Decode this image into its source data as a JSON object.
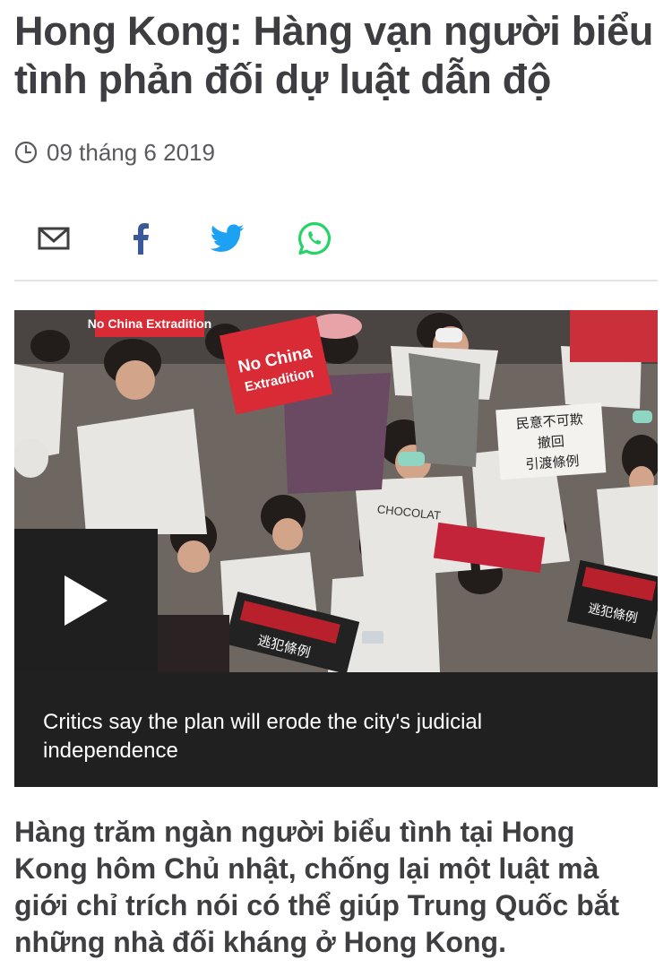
{
  "article": {
    "headline": "Hong Kong: Hàng vạn người biểu tình phản đối dự luật dẫn độ",
    "date": "09 tháng 6 2019",
    "lead": "Hàng trăm ngàn người biểu tình tại Hong Kong hôm Chủ nhật, chống lại một luật mà giới chỉ trích nói có thể giúp Trung Quốc bắt những nhà đối kháng ở Hong Kong."
  },
  "share": {
    "buttons": [
      {
        "icon": "email-icon"
      },
      {
        "icon": "facebook-icon"
      },
      {
        "icon": "twitter-icon"
      },
      {
        "icon": "whatsapp-icon"
      }
    ]
  },
  "media": {
    "caption": "Critics say the plan will erode the city's judicial independence",
    "play_icon": "play-icon",
    "signs": {
      "sign_1": "No China Extradition",
      "sign_2_line1": "No China",
      "sign_2_line2": "Extradition",
      "sign_3_line1": "民意不可欺",
      "sign_3_line2": "撤回",
      "sign_3_line3": "引渡條例",
      "sign_4": "逃犯條例",
      "shirt_text": "CHOCOLAT"
    }
  },
  "colors": {
    "text": "#3f3f42",
    "divider": "#e4e4e6",
    "facebook": "#3b5998",
    "twitter": "#1da1f2",
    "whatsapp": "#25d366",
    "caption_bg": "#202020"
  }
}
